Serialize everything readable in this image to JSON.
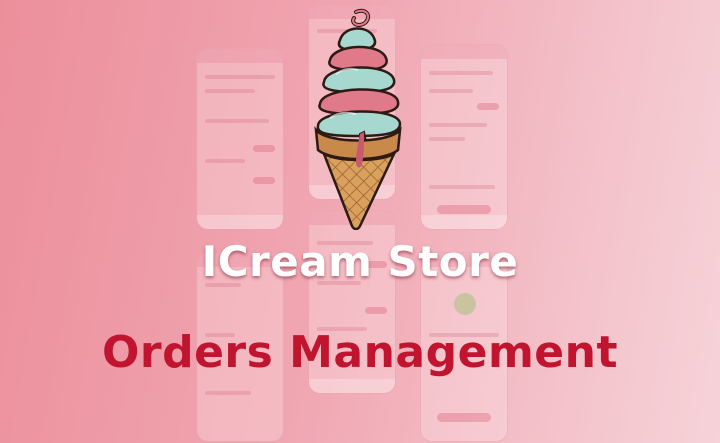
{
  "banner": {
    "title": "ICream Store",
    "subtitle": "Orders Management"
  },
  "icons": {
    "hero": "ice-cream-cone-icon",
    "success": "check-circle-icon"
  },
  "colors": {
    "background_start": "#ec8f9c",
    "background_end": "#f6d3d8",
    "title": "#ffffff",
    "subtitle": "#c0142f",
    "scoop_pink": "#e07a8b",
    "scoop_mint": "#a7d8d0",
    "wafer": "#d9a15c"
  }
}
